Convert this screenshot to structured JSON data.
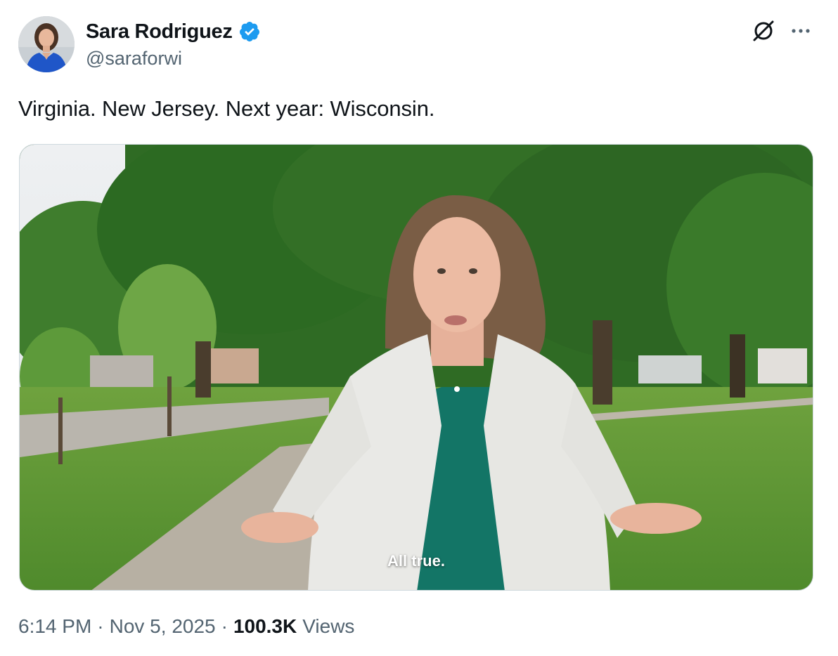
{
  "tweet": {
    "author": {
      "display_name": "Sara Rodriguez",
      "handle": "@saraforwi",
      "verified": true,
      "verified_color": "#1d9bf0",
      "avatar_icon": "profile-photo"
    },
    "text": "Virginia. New Jersey. Next year: Wisconsin.",
    "media": {
      "type": "video",
      "caption": "All true."
    },
    "meta": {
      "time": "6:14 PM",
      "separator": "·",
      "date": "Nov 5, 2025",
      "views_count": "100.3K",
      "views_label": "Views"
    }
  },
  "icons": {
    "grok": "grok-icon",
    "more": "more-options-icon"
  }
}
